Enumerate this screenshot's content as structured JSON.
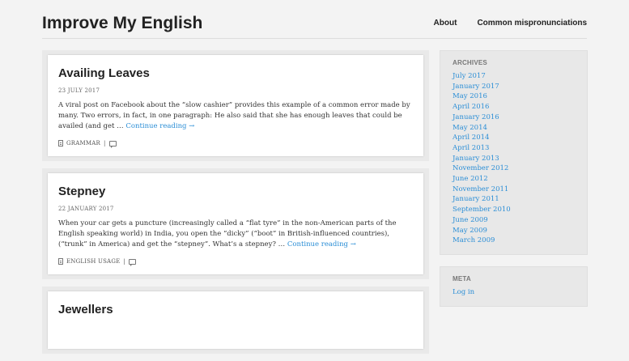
{
  "site": {
    "title": "Improve My English"
  },
  "nav": [
    {
      "label": "About"
    },
    {
      "label": "Common mispronunciations"
    }
  ],
  "posts": [
    {
      "title": "Availing Leaves",
      "date": "23 JULY 2017",
      "excerpt": "A viral post on Facebook about the “slow cashier” provides this example of a common error made by many. Two errors, in fact, in one paragraph: He also said that she has enough leaves that could be availed (and get …",
      "more": "Continue reading →",
      "category": "GRAMMAR",
      "sep": "|"
    },
    {
      "title": "Stepney",
      "date": "22 JANUARY 2017",
      "excerpt": "When your car gets a puncture (increasingly called a “flat tyre” in the non-American parts of the English speaking world) in India, you open the “dicky” (“boot” in British-influenced countries), (“trunk” in America) and get the “stepney”. What’s a stepney? …",
      "more": "Continue reading →",
      "category": "ENGLISH USAGE",
      "sep": "|"
    },
    {
      "title": "Jewellers"
    }
  ],
  "sidebar": {
    "archives": {
      "title": "ARCHIVES",
      "items": [
        "July 2017",
        "January 2017",
        "May 2016",
        "April 2016",
        "January 2016",
        "May 2014",
        "April 2014",
        "April 2013",
        "January 2013",
        "November 2012",
        "June 2012",
        "November 2011",
        "January 2011",
        "September 2010",
        "June 2009",
        "May 2009",
        "March 2009"
      ]
    },
    "meta": {
      "title": "META",
      "items": [
        "Log in"
      ]
    }
  },
  "icons": {
    "category": "document-icon",
    "comments": "comment-icon"
  },
  "colors": {
    "link": "#2b8ed6",
    "background": "#f3f3f3"
  }
}
